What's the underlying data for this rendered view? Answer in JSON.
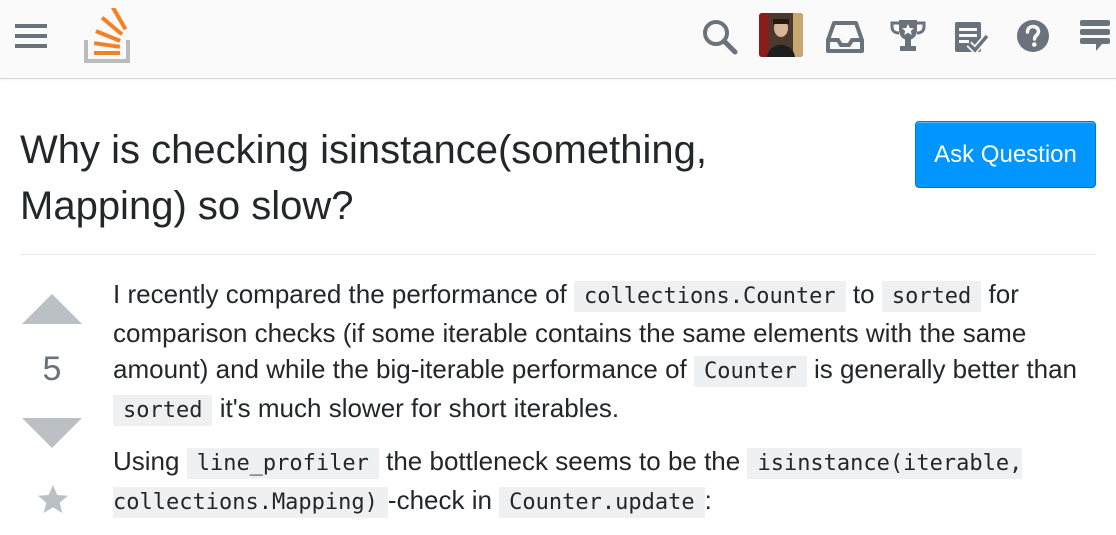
{
  "header": {
    "menu_icon": "hamburger-icon",
    "logo_icon": "stackoverflow-logo",
    "icons": [
      "search-icon",
      "avatar",
      "inbox-icon",
      "trophy-icon",
      "review-icon",
      "help-icon",
      "site-switcher-icon"
    ]
  },
  "question": {
    "title": "Why is checking isinstance(something, Mapping) so slow?",
    "ask_button": "Ask Question",
    "votes": "5"
  },
  "body": {
    "p1": {
      "t1": "I recently compared the performance of ",
      "c1": "collections.Counter",
      "t2": " to ",
      "c2": "sorted",
      "t3": " for comparison checks (if some iterable contains the same elements with the same amount) and while the big-iterable performance of ",
      "c3": "Counter",
      "t4": " is generally better than ",
      "c4": "sorted",
      "t5": " it's much slower for short iterables."
    },
    "p2": {
      "t1": "Using ",
      "c1": "line_profiler",
      "t2": " the bottleneck seems to be the ",
      "c2": "isinstance(iterable, collections.Mapping)",
      "t3": "-check in ",
      "c3": "Counter.update",
      "t4": ":"
    }
  },
  "colors": {
    "accent": "#0095ff",
    "logo_orange": "#f48024",
    "logo_gray": "#bcbbbb",
    "icon_gray": "#6a737c"
  }
}
